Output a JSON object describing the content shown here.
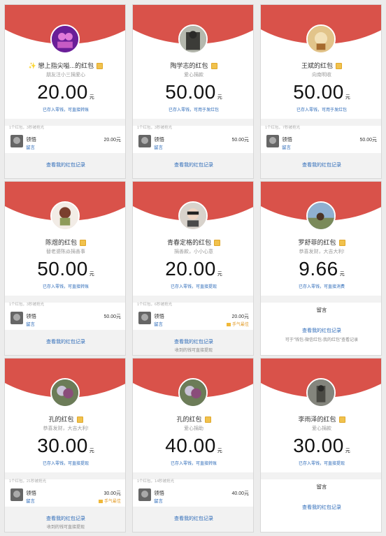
{
  "colors": {
    "header_red": "#d9524a",
    "link_blue": "#2c6ab8",
    "gold": "#e29b27"
  },
  "cards": [
    {
      "title": "✨ 戀上指尖嗌...的红包",
      "subtitle": "朋友注小三捐爱心",
      "amount": "20.00",
      "unit": "元",
      "note": "已存入零钱，可直接转账",
      "stat": "1个红包，3秒被抢光",
      "receiver_name": "领悟",
      "receiver_sub": "留言",
      "receiver_amount": "20.00元",
      "best": "",
      "footer_link": "查看我的红包记录",
      "footer_note": ""
    },
    {
      "title": "陶学志的红包",
      "subtitle": "爱心捐款",
      "amount": "50.00",
      "unit": "元",
      "note": "已存入零钱，可用于发红包",
      "stat": "1个红包，3秒被抢光",
      "receiver_name": "领悟",
      "receiver_sub": "留言",
      "receiver_amount": "50.00元",
      "best": "",
      "footer_link": "查看我的红包记录",
      "footer_note": ""
    },
    {
      "title": "王斌的红包",
      "subtitle": "向南明收",
      "amount": "50.00",
      "unit": "元",
      "note": "已存入零钱，可用于发红包",
      "stat": "1个红包，7秒被抢光",
      "receiver_name": "领悟",
      "receiver_sub": "留言",
      "receiver_amount": "50.00元",
      "best": "",
      "footer_link": "查看我的红包记录",
      "footer_note": ""
    },
    {
      "title": "陈煜的红包",
      "subtitle": "替老婆陈焱捐善事",
      "amount": "50.00",
      "unit": "元",
      "note": "已存入零钱，可直接转账",
      "stat": "1个红包，3秒被抢光",
      "receiver_name": "领悟",
      "receiver_sub": "留言",
      "receiver_amount": "50.00元",
      "best": "",
      "footer_link": "查看我的红包记录",
      "footer_note": ""
    },
    {
      "title": "青春定格的红包",
      "subtitle": "捐善款，小小心意",
      "amount": "20.00",
      "unit": "元",
      "note": "已存入零钱，可直接提现",
      "stat": "1个红包，6秒被抢光",
      "receiver_name": "领悟",
      "receiver_sub": "留言",
      "receiver_amount": "20.00元",
      "best": "手气最佳",
      "footer_link": "查看我的红包记录",
      "footer_note": "收到的钱可直接提现"
    },
    {
      "title": "罗舒菲的红包",
      "subtitle": "恭喜发财，大吉大利!",
      "amount": "9.66",
      "unit": "元",
      "note": "已存入零钱，可直接消费",
      "stat": "",
      "receiver_name": "",
      "receiver_sub": "",
      "receiver_amount": "",
      "best": "",
      "message_only": "留言",
      "footer_link": "查看我的红包记录",
      "footer_note": "可于\"钱包-微信红包-我的红包\"查看记录"
    },
    {
      "title": "孔的红包",
      "subtitle": "恭喜发财，大吉大利!",
      "amount": "30.00",
      "unit": "元",
      "note": "已存入零钱，可直接提现",
      "stat": "1个红包，21秒被抢光",
      "receiver_name": "领悟",
      "receiver_sub": "留言",
      "receiver_amount": "30.00元",
      "best": "手气最佳",
      "footer_link": "查看我的红包记录",
      "footer_note": "收到的钱可直接提现"
    },
    {
      "title": "孔的红包",
      "subtitle": "爱心捐助",
      "amount": "40.00",
      "unit": "元",
      "note": "已存入零钱，可直接转账",
      "stat": "1个红包，14秒被抢光",
      "receiver_name": "领悟",
      "receiver_sub": "留言",
      "receiver_amount": "40.00元",
      "best": "",
      "footer_link": "查看我的红包记录",
      "footer_note": ""
    },
    {
      "title": "李雨泽的红包",
      "subtitle": "爱心捐款",
      "amount": "30.00",
      "unit": "元",
      "note": "已存入零钱，可直接提现",
      "stat": "",
      "receiver_name": "",
      "receiver_sub": "",
      "receiver_amount": "",
      "best": "",
      "message_only": "留言",
      "footer_link": "查看我的红包记录",
      "footer_note": ""
    }
  ]
}
